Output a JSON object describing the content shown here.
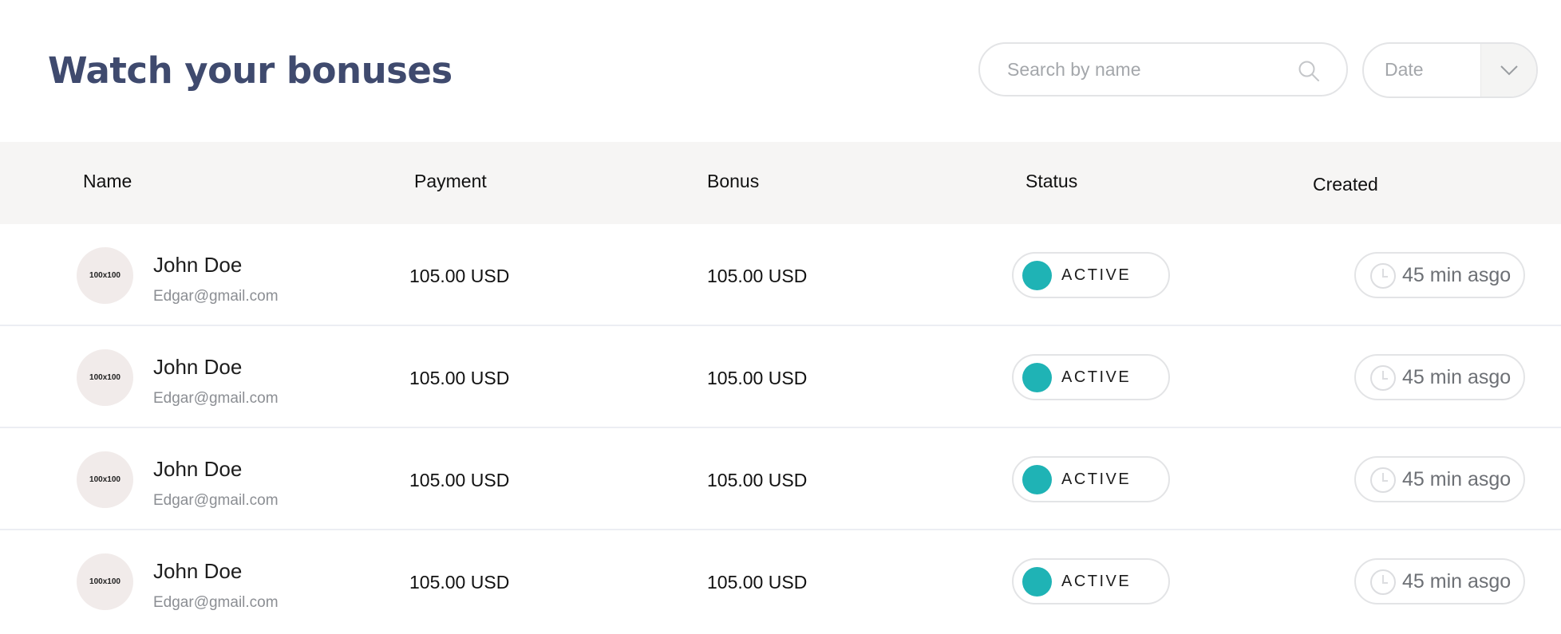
{
  "page": {
    "title": "Watch your bonuses"
  },
  "search": {
    "placeholder": "Search by name",
    "icon": "search-icon"
  },
  "date_filter": {
    "selected": "Date",
    "icon": "chevron-down-icon"
  },
  "table": {
    "columns": [
      "Name",
      "Payment",
      "Bonus",
      "Status",
      "Created"
    ],
    "rows": [
      {
        "avatar": "100x100",
        "name": "John Doe",
        "email": "Edgar@gmail.com",
        "payment": "105.00 USD",
        "bonus": "105.00 USD",
        "status": "ACTIVE",
        "created": "45 min asgo"
      },
      {
        "avatar": "100x100",
        "name": "John Doe",
        "email": "Edgar@gmail.com",
        "payment": "105.00 USD",
        "bonus": "105.00 USD",
        "status": "ACTIVE",
        "created": "45 min asgo"
      },
      {
        "avatar": "100x100",
        "name": "John Doe",
        "email": "Edgar@gmail.com",
        "payment": "105.00 USD",
        "bonus": "105.00 USD",
        "status": "ACTIVE",
        "created": "45 min asgo"
      },
      {
        "avatar": "100x100",
        "name": "John Doe",
        "email": "Edgar@gmail.com",
        "payment": "105.00 USD",
        "bonus": "105.00 USD",
        "status": "ACTIVE",
        "created": "45 min asgo"
      }
    ]
  },
  "colors": {
    "title": "#3f4a6e",
    "status_active": "#1fb3b5",
    "header_bg": "#f6f5f4",
    "avatar_bg": "#f1ebea"
  }
}
